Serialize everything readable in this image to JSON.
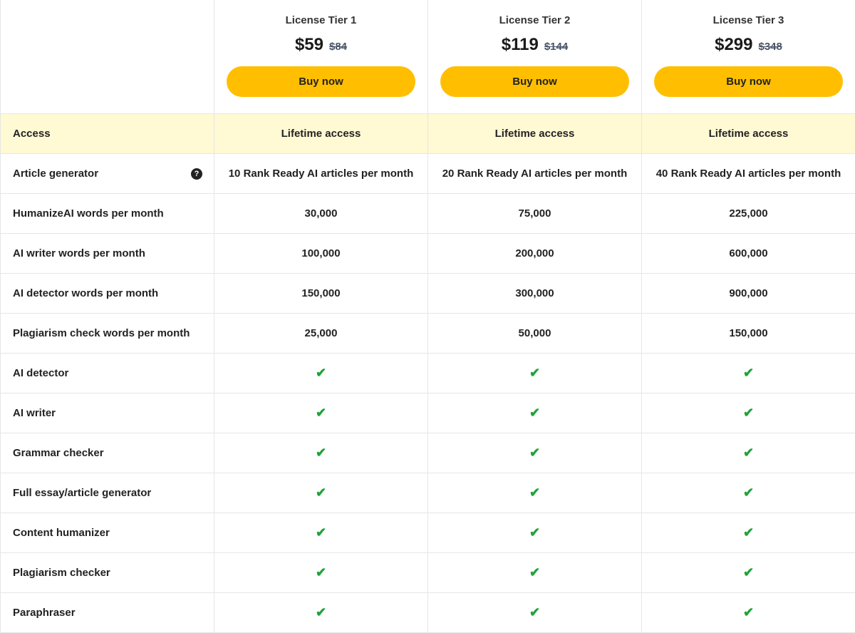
{
  "tiers": [
    {
      "name": "License Tier 1",
      "price": "$59",
      "old_price": "$84",
      "button": "Buy now"
    },
    {
      "name": "License Tier 2",
      "price": "$119",
      "old_price": "$144",
      "button": "Buy now"
    },
    {
      "name": "License Tier 3",
      "price": "$299",
      "old_price": "$348",
      "button": "Buy now"
    }
  ],
  "colors": {
    "accent": "#ffbf00",
    "highlight_row": "#fff9d4",
    "check": "#1fa33a"
  },
  "rows": [
    {
      "label": "Access",
      "highlight": true,
      "values": [
        "Lifetime access",
        "Lifetime access",
        "Lifetime access"
      ]
    },
    {
      "label": "Article generator",
      "help": true,
      "values": [
        "10 Rank Ready AI articles per month",
        "20 Rank Ready AI articles per month",
        "40 Rank Ready AI articles per month"
      ]
    },
    {
      "label": "HumanizeAI words per month",
      "values": [
        "30,000",
        "75,000",
        "225,000"
      ]
    },
    {
      "label": "AI writer words per month",
      "values": [
        "100,000",
        "200,000",
        "600,000"
      ]
    },
    {
      "label": "AI detector words per month",
      "values": [
        "150,000",
        "300,000",
        "900,000"
      ]
    },
    {
      "label": "Plagiarism check words per month",
      "values": [
        "25,000",
        "50,000",
        "150,000"
      ]
    },
    {
      "label": "AI detector",
      "check": true
    },
    {
      "label": "AI writer",
      "check": true
    },
    {
      "label": "Grammar checker",
      "check": true
    },
    {
      "label": "Full essay/article generator",
      "check": true
    },
    {
      "label": "Content humanizer",
      "check": true
    },
    {
      "label": "Plagiarism checker",
      "check": true
    },
    {
      "label": "Paraphraser",
      "check": true
    }
  ]
}
